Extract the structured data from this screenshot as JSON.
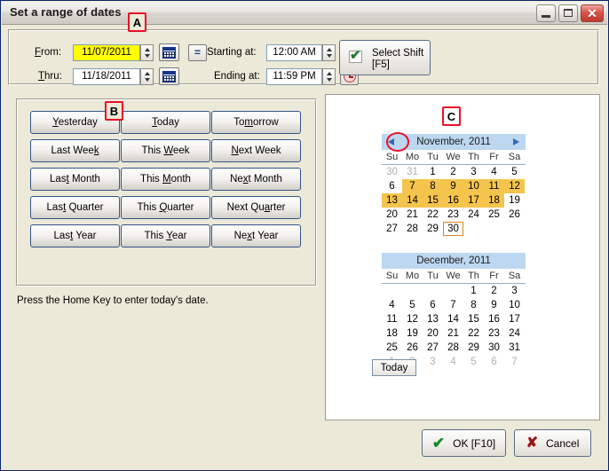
{
  "window": {
    "title": "Set a range of dates",
    "minimize_label": "Minimize",
    "maximize_label": "Maximize",
    "close_label": "✕"
  },
  "form": {
    "from_label_pre": "F",
    "from_label_accel": "r",
    "from_label_post": "om:",
    "from_label": "From:",
    "from_value": "11/07/2011",
    "thru_label": "Thru:",
    "thru_value": "11/18/2011",
    "starting_label": "Starting at:",
    "starting_value": "12:00 AM",
    "ending_label": "Ending at:",
    "ending_value": "11:59 PM",
    "equals_label": "=",
    "calendar_icon": "calendar-icon",
    "clock_icon": "clock-icon"
  },
  "shift_button": {
    "line1": "Select Shift",
    "line2": "[F5]",
    "checked": true
  },
  "quick_buttons": [
    {
      "label": "Yesterday",
      "accel_index": 0
    },
    {
      "label": "Today",
      "accel_index": 0
    },
    {
      "label": "Tomorrow",
      "accel_index": 2
    },
    {
      "label": "Last Week",
      "accel_index": 8
    },
    {
      "label": "This Week",
      "accel_index": 5
    },
    {
      "label": "Next Week",
      "accel_index": 0
    },
    {
      "label": "Last Month",
      "accel_index": 3
    },
    {
      "label": "This Month",
      "accel_index": 5
    },
    {
      "label": "Next Month",
      "accel_index": 2
    },
    {
      "label": "Last Quarter",
      "accel_index": 3
    },
    {
      "label": "This Quarter",
      "accel_index": 5
    },
    {
      "label": "Next Quarter",
      "accel_index": 7
    },
    {
      "label": "Last Year",
      "accel_index": 3
    },
    {
      "label": "This Year",
      "accel_index": 5
    },
    {
      "label": "Next Year",
      "accel_index": 2
    }
  ],
  "hint": "Press the Home Key to enter today's date.",
  "calendar": {
    "day_names": [
      "Su",
      "Mo",
      "Tu",
      "We",
      "Th",
      "Fr",
      "Sa"
    ],
    "prev_arrow": "prev-month-arrow",
    "next_arrow": "next-month-arrow",
    "today_button": "Today",
    "selection_color": "#f5c44d",
    "header_color": "#bdd7f0",
    "today_outline_color": "#cf8b1a",
    "months": [
      {
        "title": "November, 2011",
        "show_arrows": true,
        "weeks": [
          [
            {
              "d": "30",
              "other": true
            },
            {
              "d": "31",
              "other": true
            },
            {
              "d": "1"
            },
            {
              "d": "2"
            },
            {
              "d": "3"
            },
            {
              "d": "4"
            },
            {
              "d": "5"
            }
          ],
          [
            {
              "d": "6"
            },
            {
              "d": "7",
              "sel": true
            },
            {
              "d": "8",
              "sel": true
            },
            {
              "d": "9",
              "sel": true
            },
            {
              "d": "10",
              "sel": true
            },
            {
              "d": "11",
              "sel": true
            },
            {
              "d": "12",
              "sel": true
            }
          ],
          [
            {
              "d": "13",
              "sel": true
            },
            {
              "d": "14",
              "sel": true
            },
            {
              "d": "15",
              "sel": true
            },
            {
              "d": "16",
              "sel": true
            },
            {
              "d": "17",
              "sel": true
            },
            {
              "d": "18",
              "sel": true
            },
            {
              "d": "19"
            }
          ],
          [
            {
              "d": "20"
            },
            {
              "d": "21"
            },
            {
              "d": "22"
            },
            {
              "d": "23"
            },
            {
              "d": "24"
            },
            {
              "d": "25"
            },
            {
              "d": "26"
            }
          ],
          [
            {
              "d": "27"
            },
            {
              "d": "28"
            },
            {
              "d": "29"
            },
            {
              "d": "30",
              "today": true
            },
            {
              "d": ""
            },
            {
              "d": ""
            },
            {
              "d": ""
            }
          ]
        ]
      },
      {
        "title": "December, 2011",
        "show_arrows": false,
        "weeks": [
          [
            {
              "d": ""
            },
            {
              "d": ""
            },
            {
              "d": ""
            },
            {
              "d": ""
            },
            {
              "d": "1"
            },
            {
              "d": "2"
            },
            {
              "d": "3"
            }
          ],
          [
            {
              "d": "4"
            },
            {
              "d": "5"
            },
            {
              "d": "6"
            },
            {
              "d": "7"
            },
            {
              "d": "8"
            },
            {
              "d": "9"
            },
            {
              "d": "10"
            }
          ],
          [
            {
              "d": "11"
            },
            {
              "d": "12"
            },
            {
              "d": "13"
            },
            {
              "d": "14"
            },
            {
              "d": "15"
            },
            {
              "d": "16"
            },
            {
              "d": "17"
            }
          ],
          [
            {
              "d": "18"
            },
            {
              "d": "19"
            },
            {
              "d": "20"
            },
            {
              "d": "21"
            },
            {
              "d": "22"
            },
            {
              "d": "23"
            },
            {
              "d": "24"
            }
          ],
          [
            {
              "d": "25"
            },
            {
              "d": "26"
            },
            {
              "d": "27"
            },
            {
              "d": "28"
            },
            {
              "d": "29"
            },
            {
              "d": "30"
            },
            {
              "d": "31"
            }
          ],
          [
            {
              "d": "1",
              "other": true
            },
            {
              "d": "2",
              "other": true
            },
            {
              "d": "3",
              "other": true
            },
            {
              "d": "4",
              "other": true
            },
            {
              "d": "5",
              "other": true
            },
            {
              "d": "6",
              "other": true
            },
            {
              "d": "7",
              "other": true
            }
          ]
        ]
      }
    ]
  },
  "footer": {
    "ok_label": "OK [F10]",
    "cancel_label": "Cancel"
  },
  "annotations": {
    "a": "A",
    "b": "B",
    "c": "C"
  }
}
